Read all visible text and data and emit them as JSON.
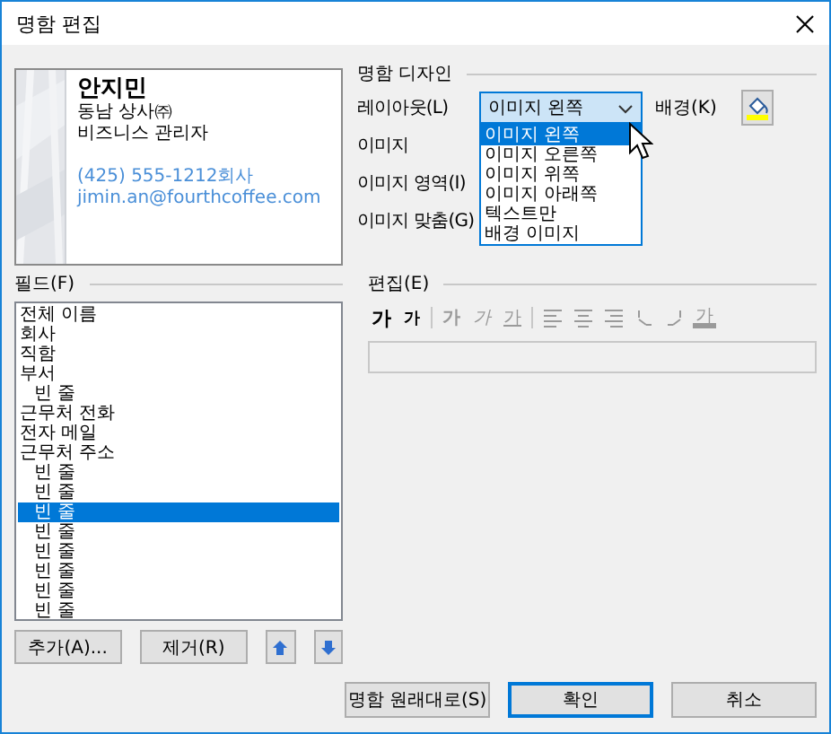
{
  "window": {
    "title": "명함 편집"
  },
  "card": {
    "name": "안지민",
    "company": "동남 상사㈜",
    "job_title": "비즈니스 관리자",
    "phone": "(425) 555-1212회사",
    "email": "jimin.an@fourthcoffee.com"
  },
  "design": {
    "heading": "명함 디자인",
    "layout_label": "레이아웃(L)",
    "layout_value": "이미지 왼쪽",
    "layout_expanded": true,
    "layout_options": [
      {
        "label": "이미지 왼쪽",
        "selected": true
      },
      {
        "label": "이미지 오른쪽",
        "selected": false
      },
      {
        "label": "이미지 위쪽",
        "selected": false
      },
      {
        "label": "이미지 아래쪽",
        "selected": false
      },
      {
        "label": "텍스트만",
        "selected": false
      },
      {
        "label": "배경 이미지",
        "selected": false
      }
    ],
    "background_label": "배경(K)",
    "image_label": "이미지",
    "image_area_label": "이미지 영역(I)",
    "image_fit_label": "이미지 맞춤(G)"
  },
  "fields": {
    "heading": "필드(F)",
    "items": [
      {
        "label": "전체 이름",
        "selected": false
      },
      {
        "label": "회사",
        "selected": false
      },
      {
        "label": "직함",
        "selected": false
      },
      {
        "label": "부서",
        "selected": false,
        "children": [
          {
            "label": "빈 줄",
            "selected": false
          }
        ]
      },
      {
        "label": "근무처 전화",
        "selected": false
      },
      {
        "label": "전자 메일",
        "selected": false
      },
      {
        "label": "근무처 주소",
        "selected": false,
        "children": [
          {
            "label": "빈 줄",
            "selected": false
          },
          {
            "label": "빈 줄",
            "selected": false
          },
          {
            "label": "빈 줄",
            "selected": true
          },
          {
            "label": "빈 줄",
            "selected": false
          },
          {
            "label": "빈 줄",
            "selected": false
          },
          {
            "label": "빈 줄",
            "selected": false
          },
          {
            "label": "빈 줄",
            "selected": false
          },
          {
            "label": "빈 줄",
            "selected": false
          }
        ]
      }
    ],
    "add_button": "추가(A)...",
    "remove_button": "제거(R)"
  },
  "edit": {
    "heading": "편집(E)",
    "toolbar": [
      {
        "kind": "grow",
        "label": "가",
        "disabled": false
      },
      {
        "kind": "shrink",
        "label": "가",
        "disabled": false
      },
      {
        "kind": "separator"
      },
      {
        "kind": "bold",
        "label": "가",
        "disabled": true
      },
      {
        "kind": "italic",
        "label": "가",
        "disabled": true
      },
      {
        "kind": "underline",
        "label": "가",
        "disabled": true
      },
      {
        "kind": "separator"
      },
      {
        "kind": "align-left",
        "disabled": true
      },
      {
        "kind": "align-center",
        "disabled": true
      },
      {
        "kind": "align-right",
        "disabled": true
      },
      {
        "kind": "wrap-left",
        "disabled": true
      },
      {
        "kind": "wrap-right",
        "disabled": true
      },
      {
        "kind": "font-color",
        "label": "가",
        "disabled": true
      }
    ]
  },
  "footer": [
    {
      "label": "명함 원래대로(S)",
      "default": false
    },
    {
      "label": "확인",
      "default": true
    },
    {
      "label": "취소",
      "default": false
    }
  ]
}
